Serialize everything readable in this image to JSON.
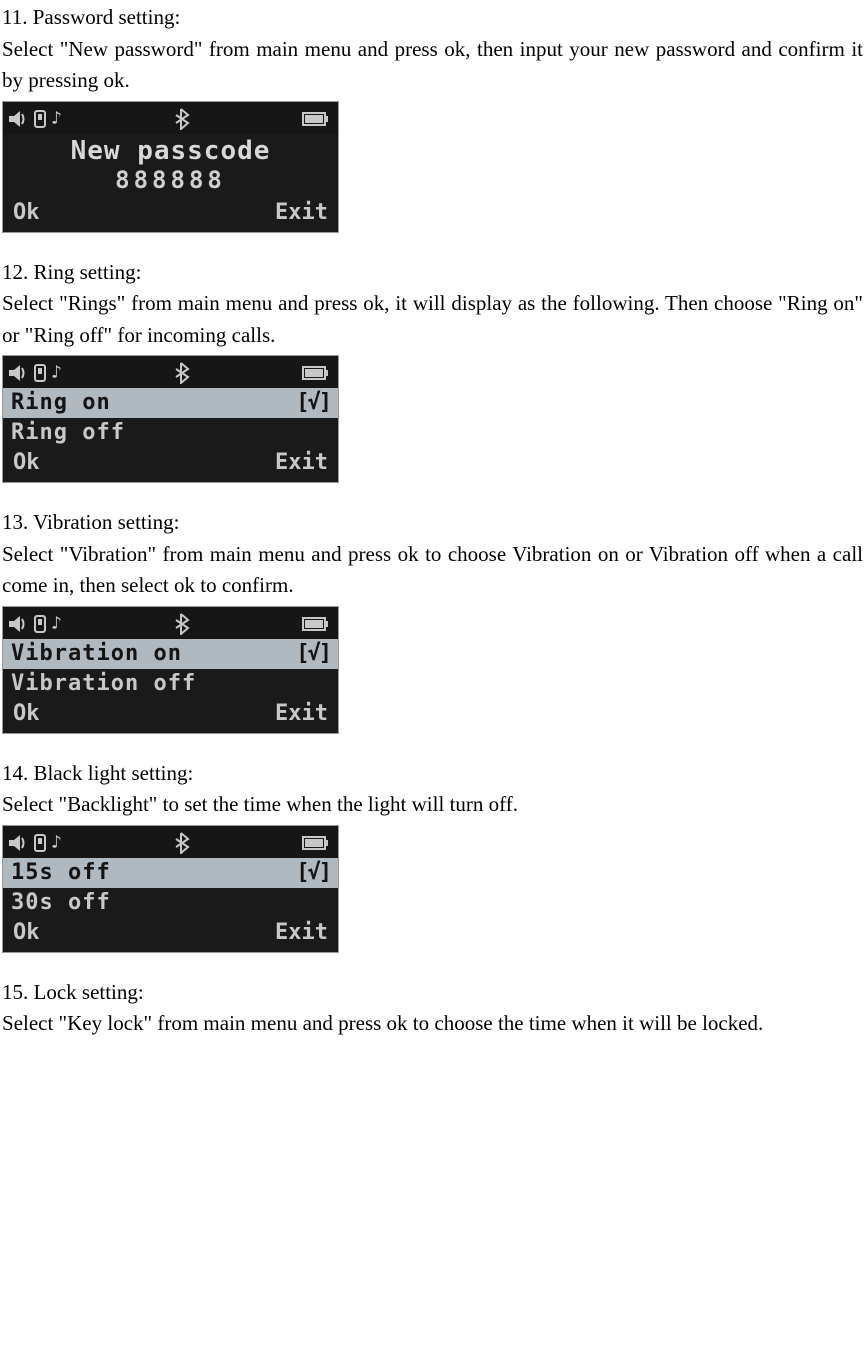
{
  "sections": {
    "s11": {
      "heading": "11. Password setting:",
      "body": "Select \"New password\" from main menu and press ok, then input your new password and confirm it by pressing ok.",
      "screen": {
        "title": "New passcode",
        "value": "888888",
        "ok": "Ok",
        "exit": "Exit"
      }
    },
    "s12": {
      "heading": "12. Ring setting:",
      "body": "Select \"Rings\" from main menu and press ok, it will display as the following. Then choose \"Ring on\" or \"Ring off\" for incoming calls.",
      "screen": {
        "row1": "Ring on",
        "row1_check": "[√]",
        "row2": "Ring off",
        "ok": "Ok",
        "exit": "Exit"
      }
    },
    "s13": {
      "heading": "13. Vibration setting:",
      "body": "Select \"Vibration\" from main menu and press ok to choose Vibration on or Vibration off when a call come in, then select ok to confirm.",
      "screen": {
        "row1": "Vibration on",
        "row1_check": "[√]",
        "row2": "Vibration off",
        "ok": "Ok",
        "exit": "Exit"
      }
    },
    "s14": {
      "heading": "14. Black light setting:",
      "body": "Select \"Backlight\" to set the time when the light will turn off.",
      "screen": {
        "row1": "15s off",
        "row1_check": "[√]",
        "row2": "30s off",
        "ok": "Ok",
        "exit": "Exit"
      }
    },
    "s15": {
      "heading": "15. Lock setting:",
      "body": "Select \"Key lock\" from main menu and press ok to choose the time when it will be locked."
    }
  }
}
